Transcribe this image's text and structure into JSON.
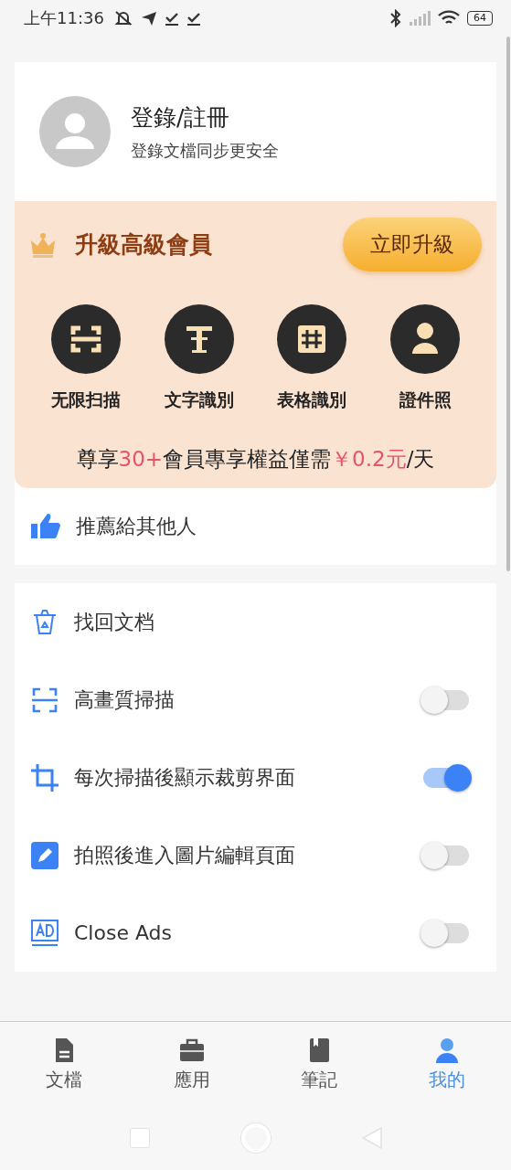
{
  "status_bar": {
    "time": "上午11:36",
    "battery": "64"
  },
  "profile": {
    "title": "登錄/註冊",
    "subtitle": "登錄文檔同步更安全"
  },
  "vip": {
    "title": "升級高級會員",
    "button": "立即升級",
    "features": [
      {
        "kind": "scan",
        "label": "无限扫描"
      },
      {
        "kind": "text",
        "label": "文字識別"
      },
      {
        "kind": "table",
        "label": "表格識別"
      },
      {
        "kind": "photo",
        "label": "證件照"
      }
    ],
    "promo_parts": [
      {
        "text": "尊享",
        "accent": false
      },
      {
        "text": "30+",
        "accent": true
      },
      {
        "text": "會員專享權益僅需",
        "accent": false
      },
      {
        "text": "￥0.2元",
        "accent": true
      },
      {
        "text": "/天",
        "accent": false
      }
    ]
  },
  "recommend": {
    "label": "推薦給其他人"
  },
  "settings": [
    {
      "kind": "link",
      "label": "找回文档"
    },
    {
      "kind": "toggle",
      "label": "高畫質掃描",
      "on": false
    },
    {
      "kind": "toggle",
      "label": "每次掃描後顯示裁剪界面",
      "on": true
    },
    {
      "kind": "toggle",
      "label": "拍照後進入圖片編輯頁面",
      "on": false
    },
    {
      "kind": "toggle",
      "label": "Close Ads",
      "on": false
    }
  ],
  "tabs": [
    {
      "label": "文檔",
      "selected": false
    },
    {
      "label": "應用",
      "selected": false
    },
    {
      "label": "筆記",
      "selected": false
    },
    {
      "label": "我的",
      "selected": true
    }
  ]
}
